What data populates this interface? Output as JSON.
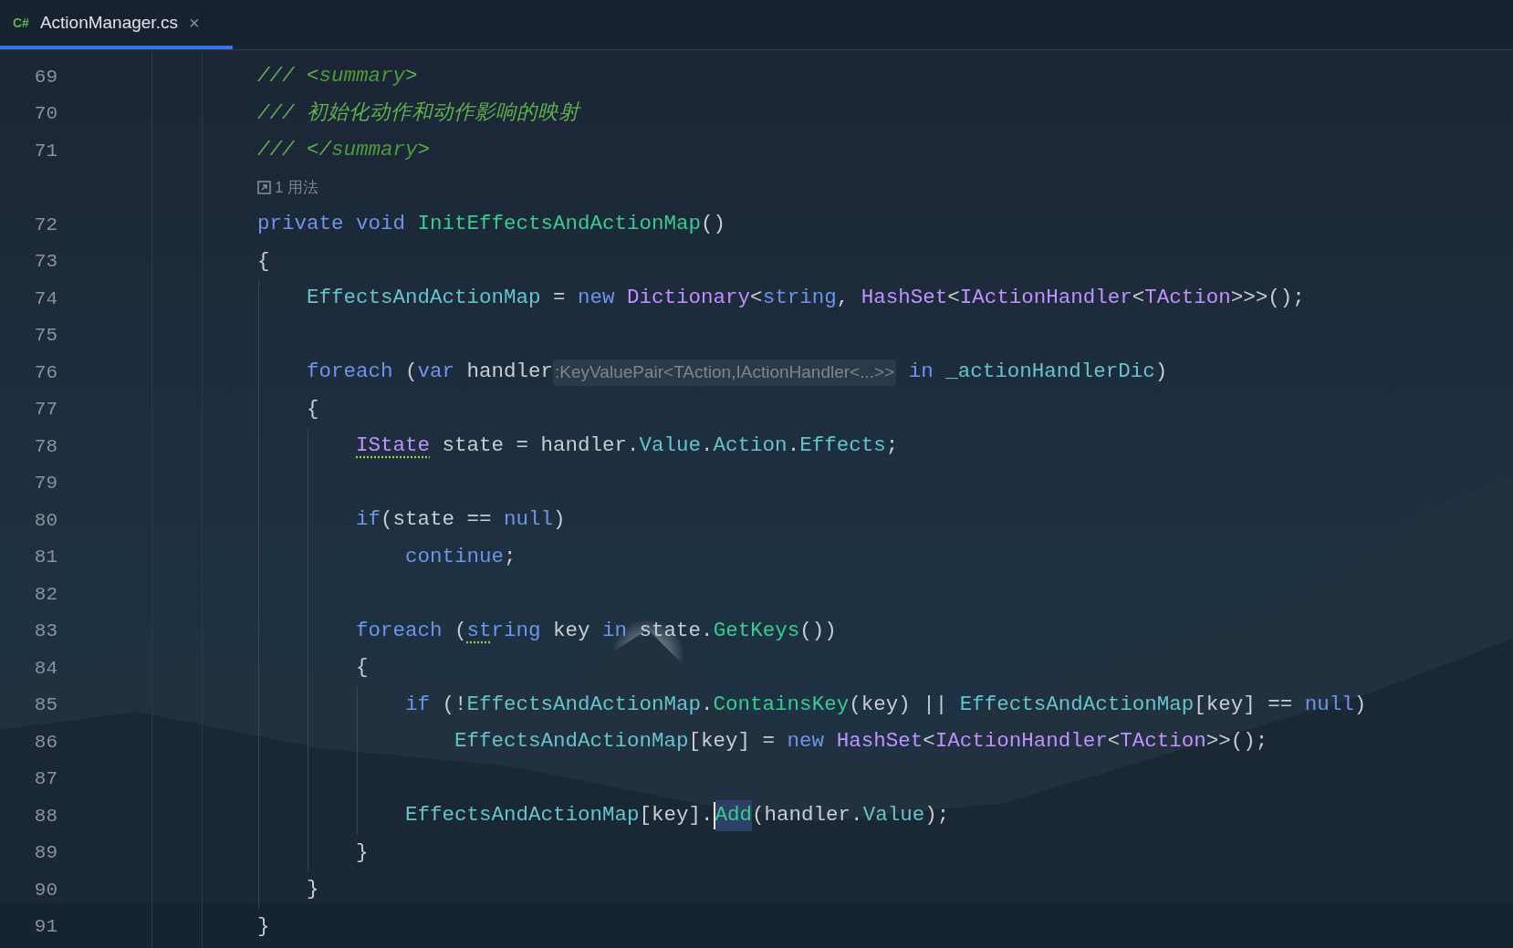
{
  "tab": {
    "icon_text": "C#",
    "label": "ActionManager.cs",
    "close": "×",
    "selected": true
  },
  "lines": [
    {
      "kind": "code",
      "number": "69",
      "tokens": [
        {
          "kind": "comment",
          "text": "/// <"
        },
        {
          "kind": "doctag",
          "text": "summary"
        },
        {
          "kind": "comment",
          "text": ">"
        }
      ]
    },
    {
      "kind": "code",
      "number": "70",
      "tokens": [
        {
          "kind": "comment",
          "text": "/// 初始化动作和动作影响的映射"
        }
      ]
    },
    {
      "kind": "code",
      "number": "71",
      "tokens": [
        {
          "kind": "comment",
          "text": "/// </"
        },
        {
          "kind": "doctag",
          "text": "summary"
        },
        {
          "kind": "comment",
          "text": ">"
        }
      ]
    },
    {
      "kind": "usages",
      "text": "1 用法"
    },
    {
      "kind": "code",
      "number": "72",
      "tokens": [
        {
          "kind": "keyword",
          "text": "private void "
        },
        {
          "kind": "method",
          "text": "InitEffectsAndActionMap"
        },
        {
          "kind": "plain",
          "text": "()"
        }
      ]
    },
    {
      "kind": "block",
      "number": "73",
      "tokens": [
        {
          "kind": "plain",
          "text": "{"
        }
      ],
      "children": [
        {
          "kind": "code",
          "number": "74",
          "tokens": [
            {
              "kind": "field",
              "text": "EffectsAndActionMap"
            },
            {
              "kind": "plain",
              "text": " = "
            },
            {
              "kind": "keyword",
              "text": "new "
            },
            {
              "kind": "type",
              "text": "Dictionary"
            },
            {
              "kind": "plain",
              "text": "<"
            },
            {
              "kind": "keyword",
              "text": "string"
            },
            {
              "kind": "plain",
              "text": ", "
            },
            {
              "kind": "type",
              "text": "HashSet"
            },
            {
              "kind": "plain",
              "text": "<"
            },
            {
              "kind": "type",
              "text": "IActionHandler"
            },
            {
              "kind": "plain",
              "text": "<"
            },
            {
              "kind": "type",
              "text": "TAction"
            },
            {
              "kind": "plain",
              "text": ">>>();"
            }
          ]
        },
        {
          "kind": "code",
          "number": "75"
        },
        {
          "kind": "code",
          "number": "76",
          "tokens": [
            {
              "kind": "keyword",
              "text": "foreach"
            },
            {
              "kind": "plain",
              "text": " ("
            },
            {
              "kind": "keyword",
              "text": "var"
            },
            {
              "kind": "plain",
              "text": " handler"
            },
            {
              "kind": "hint",
              "text": ":KeyValuePair<TAction,IActionHandler<...>>"
            },
            {
              "kind": "keyword",
              "text": " in "
            },
            {
              "kind": "field",
              "text": "_actionHandlerDic"
            },
            {
              "kind": "plain",
              "text": ")"
            }
          ]
        },
        {
          "kind": "block",
          "number": "77",
          "tokens": [
            {
              "kind": "plain",
              "text": "{"
            }
          ],
          "children": [
            {
              "kind": "code",
              "number": "78",
              "tokens": [
                {
                  "kind": "type",
                  "text": "IState",
                  "warning": true
                },
                {
                  "kind": "plain",
                  "text": " state = handler."
                },
                {
                  "kind": "field",
                  "text": "Value"
                },
                {
                  "kind": "plain",
                  "text": "."
                },
                {
                  "kind": "field",
                  "text": "Action"
                },
                {
                  "kind": "plain",
                  "text": "."
                },
                {
                  "kind": "field",
                  "text": "Effects"
                },
                {
                  "kind": "plain",
                  "text": ";"
                }
              ]
            },
            {
              "kind": "code",
              "number": "79"
            },
            {
              "kind": "code",
              "number": "80",
              "tokens": [
                {
                  "kind": "keyword",
                  "text": "if"
                },
                {
                  "kind": "plain",
                  "text": "(state == "
                },
                {
                  "kind": "keyword",
                  "text": "null"
                },
                {
                  "kind": "plain",
                  "text": ")"
                }
              ],
              "children": [
                {
                  "kind": "code",
                  "number": "81",
                  "tokens": [
                    {
                      "kind": "keyword",
                      "text": "continue"
                    },
                    {
                      "kind": "plain",
                      "text": ";"
                    }
                  ]
                }
              ]
            },
            {
              "kind": "code",
              "number": "82"
            },
            {
              "kind": "code",
              "number": "83",
              "tokens": [
                {
                  "kind": "keyword",
                  "text": "foreach"
                },
                {
                  "kind": "plain",
                  "text": " ("
                },
                {
                  "kind": "keyword",
                  "text": "st",
                  "warning": true
                },
                {
                  "kind": "keyword",
                  "text": "ring"
                },
                {
                  "kind": "plain",
                  "text": " key "
                },
                {
                  "kind": "keyword",
                  "text": "in"
                },
                {
                  "kind": "plain",
                  "text": " state."
                },
                {
                  "kind": "method",
                  "text": "GetKeys"
                },
                {
                  "kind": "plain",
                  "text": "())"
                }
              ]
            },
            {
              "kind": "block",
              "number": "84",
              "tokens": [
                {
                  "kind": "plain",
                  "text": "{"
                }
              ],
              "children": [
                {
                  "kind": "code",
                  "number": "85",
                  "tokens": [
                    {
                      "kind": "keyword",
                      "text": "if"
                    },
                    {
                      "kind": "plain",
                      "text": " (!"
                    },
                    {
                      "kind": "field",
                      "text": "EffectsAndActionMap"
                    },
                    {
                      "kind": "plain",
                      "text": "."
                    },
                    {
                      "kind": "method",
                      "text": "ContainsKey"
                    },
                    {
                      "kind": "plain",
                      "text": "(key) || "
                    },
                    {
                      "kind": "field",
                      "text": "EffectsAndActionMap"
                    },
                    {
                      "kind": "plain",
                      "text": "[key] == "
                    },
                    {
                      "kind": "keyword",
                      "text": "null"
                    },
                    {
                      "kind": "plain",
                      "text": ")"
                    }
                  ],
                  "children": [
                    {
                      "kind": "code",
                      "number": "86",
                      "tokens": [
                        {
                          "kind": "field",
                          "text": "EffectsAndActionMap"
                        },
                        {
                          "kind": "plain",
                          "text": "[key] = "
                        },
                        {
                          "kind": "keyword",
                          "text": "new "
                        },
                        {
                          "kind": "type",
                          "text": "HashSet"
                        },
                        {
                          "kind": "plain",
                          "text": "<"
                        },
                        {
                          "kind": "type",
                          "text": "IActionHandler"
                        },
                        {
                          "kind": "plain",
                          "text": "<"
                        },
                        {
                          "kind": "type",
                          "text": "TAction"
                        },
                        {
                          "kind": "plain",
                          "text": ">>();"
                        }
                      ]
                    }
                  ]
                },
                {
                  "kind": "code",
                  "number": "87"
                },
                {
                  "kind": "code",
                  "number": "88",
                  "tokens": [
                    {
                      "kind": "field",
                      "text": "EffectsAndActionMap"
                    },
                    {
                      "kind": "plain",
                      "text": "[key]."
                    },
                    {
                      "kind": "method",
                      "text": "Add",
                      "caret": true
                    },
                    {
                      "kind": "plain",
                      "text": "(handler."
                    },
                    {
                      "kind": "field",
                      "text": "Value"
                    },
                    {
                      "kind": "plain",
                      "text": ");"
                    }
                  ]
                }
              ]
            },
            {
              "kind": "code",
              "number": "89",
              "tokens": [
                {
                  "kind": "plain",
                  "text": "}"
                }
              ]
            }
          ]
        },
        {
          "kind": "code",
          "number": "90",
          "tokens": [
            {
              "kind": "plain",
              "text": "}"
            }
          ]
        }
      ]
    },
    {
      "kind": "code",
      "number": "91",
      "tokens": [
        {
          "kind": "plain",
          "text": "}"
        }
      ]
    }
  ]
}
